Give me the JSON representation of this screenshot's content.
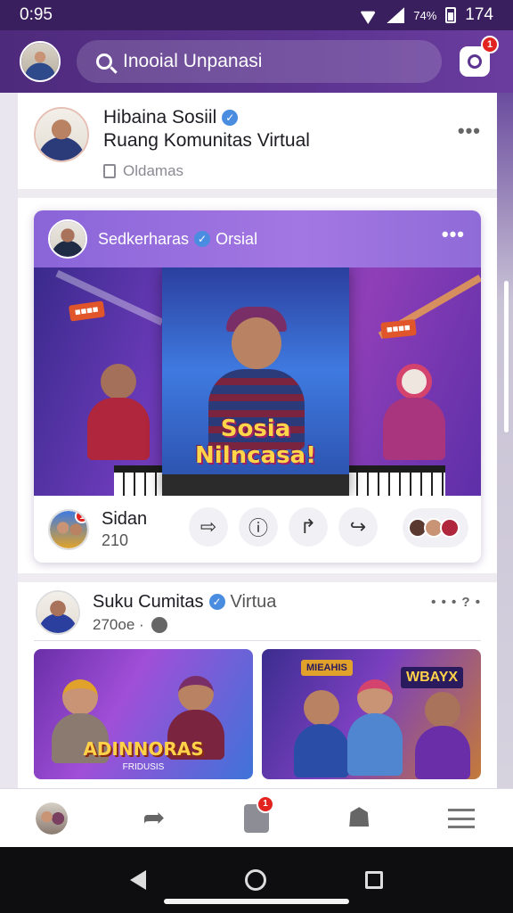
{
  "status_bar": {
    "time": "0:95",
    "right_text": "74%",
    "battery": "174"
  },
  "app_bar": {
    "search_text": "Inooial Unpanasi",
    "camera_badge": "1"
  },
  "group": {
    "name": "Hibaina Sosiil",
    "subtitle": "Ruang Komunitas Virtual",
    "meta": "Oldamas"
  },
  "post1": {
    "author": "Sedkerharas",
    "tag": "Orsial",
    "image_title": "Sosia Nilncasa!",
    "commenter_name": "Sidan",
    "commenter_count": "210",
    "commenter_badge": "1"
  },
  "post2": {
    "author": "Suku Cumitas",
    "tag": "Virtua",
    "time": "270oe ·",
    "more": "• • • ? •",
    "thumb1_title": "ADINNORAS",
    "thumb1_sub": "FRIDUSIS",
    "thumb2_sign1": "MIEAHIS",
    "thumb2_sign2": "WBAYX"
  },
  "bottom_nav": {
    "notification_badge": "1"
  },
  "icons": {
    "search": "search-icon",
    "camera": "camera-icon",
    "share": "share-icon",
    "info": "info-icon",
    "forward": "forward-icon",
    "reply": "reply-icon"
  },
  "colors": {
    "brand": "#5c3490",
    "accent": "#8a65d8",
    "badge": "#e2231f"
  }
}
